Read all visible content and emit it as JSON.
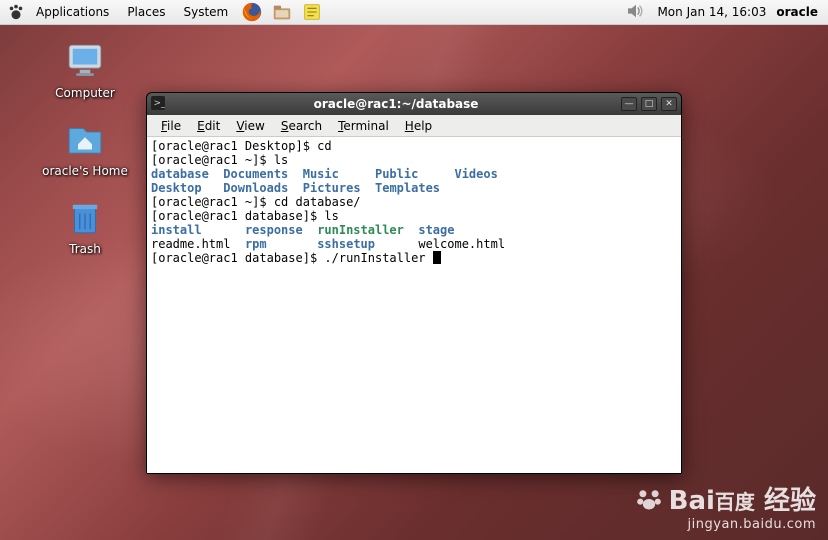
{
  "panel": {
    "menus": [
      "Applications",
      "Places",
      "System"
    ],
    "clock": "Mon Jan 14, 16:03",
    "user": "oracle"
  },
  "desktop_icons": {
    "computer": "Computer",
    "home": "oracle's Home",
    "trash": "Trash"
  },
  "window": {
    "title": "oracle@rac1:~/database",
    "menus": {
      "file": "File",
      "edit": "Edit",
      "view": "View",
      "search": "Search",
      "terminal": "Terminal",
      "help": "Help"
    }
  },
  "terminal": {
    "l1": "[oracle@rac1 Desktop]$ cd",
    "l2": "[oracle@rac1 ~]$ ls",
    "l3a": "database",
    "l3b": "Documents",
    "l3c": "Music",
    "l3d": "Public",
    "l3e": "Videos",
    "l4a": "Desktop",
    "l4b": "Downloads",
    "l4c": "Pictures",
    "l4d": "Templates",
    "l5": "[oracle@rac1 ~]$ cd database/",
    "l6": "[oracle@rac1 database]$ ls",
    "l7a": "install",
    "l7b": "response",
    "l7c": "runInstaller",
    "l7d": "stage",
    "l8a": "readme.html",
    "l8b": "rpm",
    "l8c": "sshsetup",
    "l8d": "welcome.html",
    "l9": "[oracle@rac1 database]$ ./runInstaller "
  },
  "watermark": {
    "brand": "Bai",
    "brand2": "百度",
    "suffix": "经验",
    "url": "jingyan.baidu.com"
  }
}
